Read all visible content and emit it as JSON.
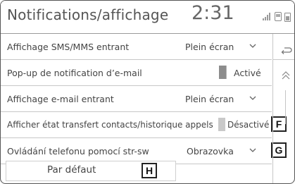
{
  "header": {
    "title": "Notifications/affichage",
    "clock": "2:31",
    "status_icons": [
      "signal-icon",
      "phone-icon",
      "battery-icon"
    ]
  },
  "settings": [
    {
      "label": "Affichage SMS/MMS entrant",
      "value": "Plein écran",
      "control": "dropdown"
    },
    {
      "label": "Pop-up de notification d’e-mail",
      "value": "Activé",
      "control": "toggle"
    },
    {
      "label": "Affichage e-mail entrant",
      "value": "Plein écran",
      "control": "dropdown"
    },
    {
      "label": "Afficher état transfert contacts/historique appels",
      "value": "Désactivé",
      "control": "toggle",
      "callout": "F"
    },
    {
      "label": "Ovládání telefonu pomocí str-sw",
      "value": "Obrazovka",
      "control": "dropdown",
      "callout": "G"
    }
  ],
  "default_button": {
    "label": "Par défaut",
    "callout": "H"
  },
  "side_controls": [
    "back-icon",
    "scroll-up-icon"
  ],
  "colors": {
    "border": "#555555",
    "separator": "#c7c7c7",
    "toggle_active": "#8c8c8c",
    "text": "#444444"
  }
}
